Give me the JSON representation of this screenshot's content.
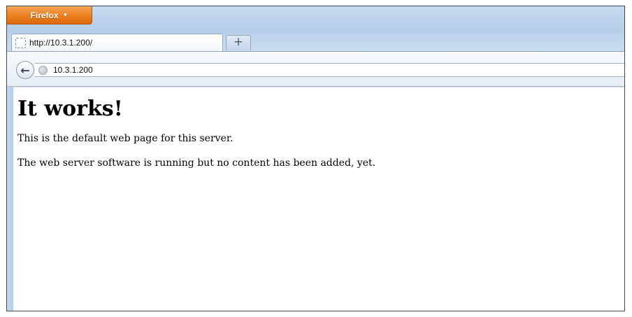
{
  "browser": {
    "menu_button_label": "Firefox",
    "tab": {
      "title": "http://10.3.1.200/"
    },
    "new_tab_label": "+",
    "back_label": "←",
    "address": "10.3.1.200"
  },
  "page": {
    "heading": "It works!",
    "paragraphs": [
      "This is the default web page for this server.",
      "The web server software is running but no content has been added, yet."
    ]
  },
  "colors": {
    "firefox_button": "#e67e22",
    "titlebar": "#c6d9ee"
  },
  "icons": {
    "tab_page_icon": "dashed-square",
    "menu_caret": "chevron-down",
    "back": "left-arrow",
    "site_identity": "globe"
  }
}
